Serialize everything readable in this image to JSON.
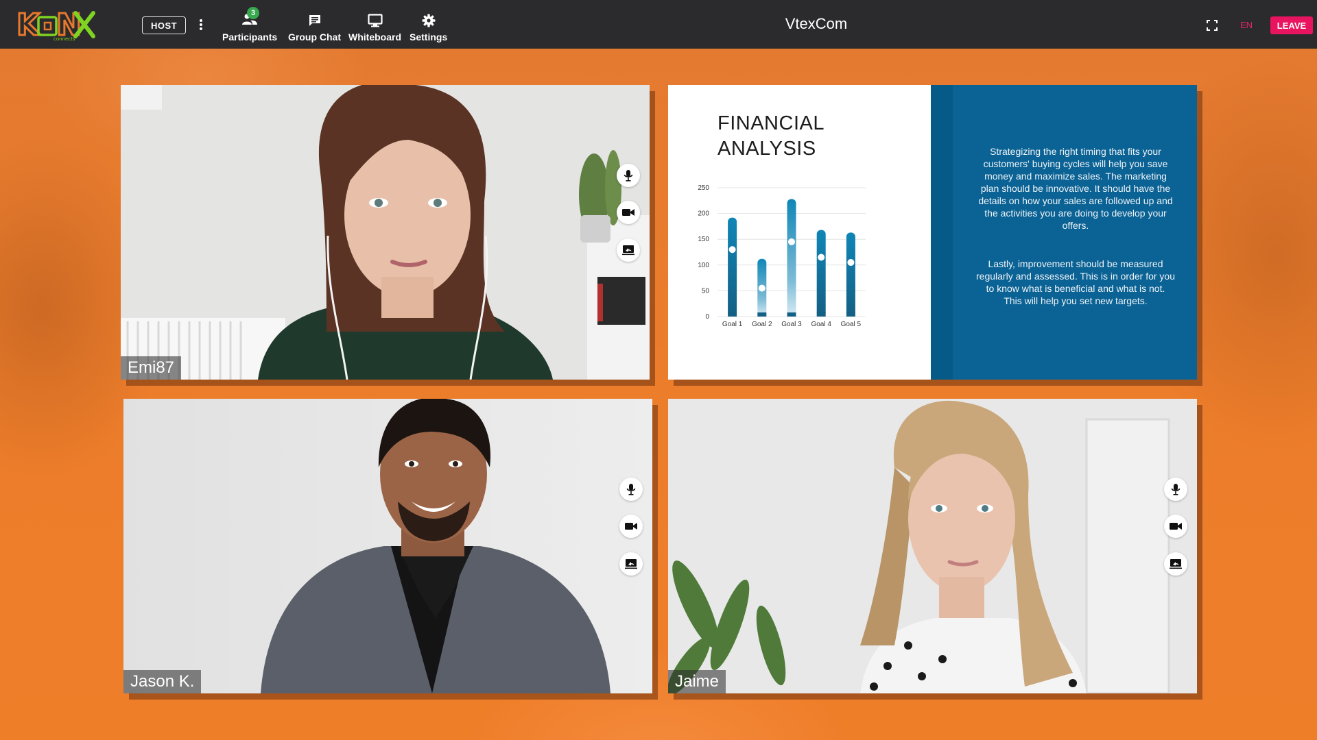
{
  "app": {
    "logo_text": "KONX",
    "logo_subtext": "connects",
    "title": "VtexCom",
    "host_label": "HOST",
    "language": "EN",
    "leave_label": "LEAVE"
  },
  "toolbar": [
    {
      "label": "Participants",
      "icon": "participants-icon",
      "badge": "3"
    },
    {
      "label": "Group Chat",
      "icon": "chat-icon"
    },
    {
      "label": "Whiteboard",
      "icon": "monitor-icon"
    },
    {
      "label": "Settings",
      "icon": "gear-icon"
    }
  ],
  "participants": [
    {
      "name": "Emi87"
    },
    {
      "name": "Jason K."
    },
    {
      "name": "Jaime"
    }
  ],
  "tile_controls": [
    "mic-icon",
    "camera-icon",
    "screen-share-icon"
  ],
  "colors": {
    "topbar": "#2b2b2d",
    "background": "#ec7d2b",
    "leave": "#e8145f",
    "badge": "#36a84e",
    "slide_panel": "#0b6294",
    "bar": "#13789f"
  },
  "slide": {
    "title": "FINANCIAL\nANALYSIS",
    "paragraph_1": "Strategizing the right timing that fits your customers' buying cycles will help you save money and maximize sales. The marketing plan should be innovative. It should have the details on how your sales are followed up and the activities you are doing to develop your offers.",
    "paragraph_2": "Lastly, improvement should be measured regularly and assessed. This is in order for you to know what is beneficial and what is not. This will help you set new targets."
  },
  "chart_data": {
    "type": "bar",
    "categories": [
      "Goal 1",
      "Goal 2",
      "Goal 3",
      "Goal 4",
      "Goal 5"
    ],
    "values": [
      192,
      112,
      228,
      168,
      163
    ],
    "markers": [
      130,
      55,
      145,
      115,
      105
    ],
    "yticks": [
      0,
      50,
      100,
      150,
      200,
      250
    ],
    "ylim": [
      0,
      250
    ],
    "grid": true
  }
}
